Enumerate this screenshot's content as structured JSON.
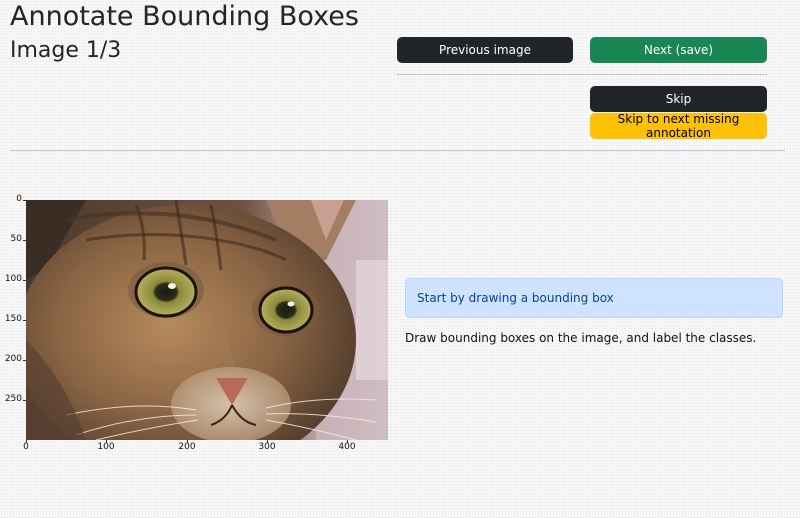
{
  "header": {
    "title": "Annotate Bounding Boxes",
    "subtitle": "Image 1/3"
  },
  "buttons": {
    "previous": "Previous image",
    "next": "Next (save)",
    "skip": "Skip",
    "skip_missing": "Skip to next missing annotation"
  },
  "plot": {
    "image_alt": "cat photo",
    "y_ticks": [
      "0",
      "50",
      "100",
      "150",
      "200",
      "250"
    ],
    "x_ticks": [
      "0",
      "100",
      "200",
      "300",
      "400"
    ],
    "x_range": [
      0,
      451
    ],
    "y_range": [
      0,
      300
    ]
  },
  "alert": {
    "text": "Start by drawing a bounding box"
  },
  "instructions": "Draw bounding boxes on the image, and label the classes.",
  "colors": {
    "dark_button": "#212529",
    "green_button": "#198754",
    "yellow_button": "#ffc107",
    "alert_bg": "#cfe2ff"
  }
}
